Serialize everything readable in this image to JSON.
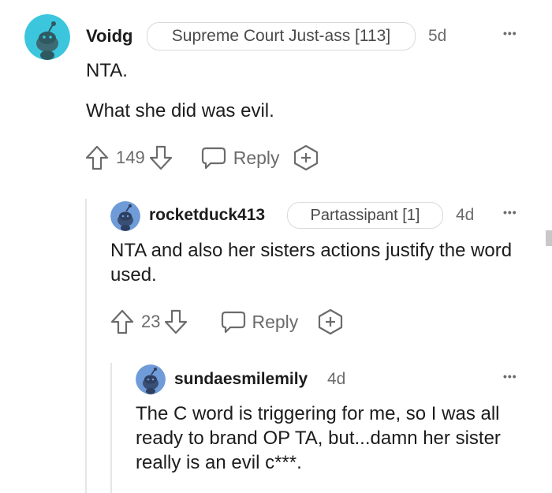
{
  "comments": [
    {
      "username": "Voidg",
      "flair": "Supreme Court Just-ass [113]",
      "time": "5d",
      "more": "•••",
      "body": [
        "NTA.",
        "What she did was evil."
      ],
      "score": "149",
      "reply_label": "Reply",
      "avatar_color": "#3bc6de"
    },
    {
      "username": "rocketduck413",
      "flair": "Partassipant [1]",
      "time": "4d",
      "more": "•••",
      "body": [
        "NTA and also her sisters actions justify the word used."
      ],
      "score": "23",
      "reply_label": "Reply",
      "avatar_color": "#6f9bd8"
    },
    {
      "username": "sundaesmilemily",
      "time": "4d",
      "more": "•••",
      "body": [
        "The C word is triggering for me, so I was all ready to brand OP TA, but...damn her sister really is an evil c***."
      ],
      "avatar_color": "#6f9bd8"
    }
  ],
  "colors": {
    "text": "#1c1c1c",
    "meta": "#6b6b6b",
    "border": "#d7dadc",
    "thread_line": "#e4e6e8"
  },
  "icons": [
    "snoo-avatar-icon",
    "upvote-icon",
    "downvote-icon",
    "reply-bubble-icon",
    "award-icon",
    "more-options-icon"
  ]
}
